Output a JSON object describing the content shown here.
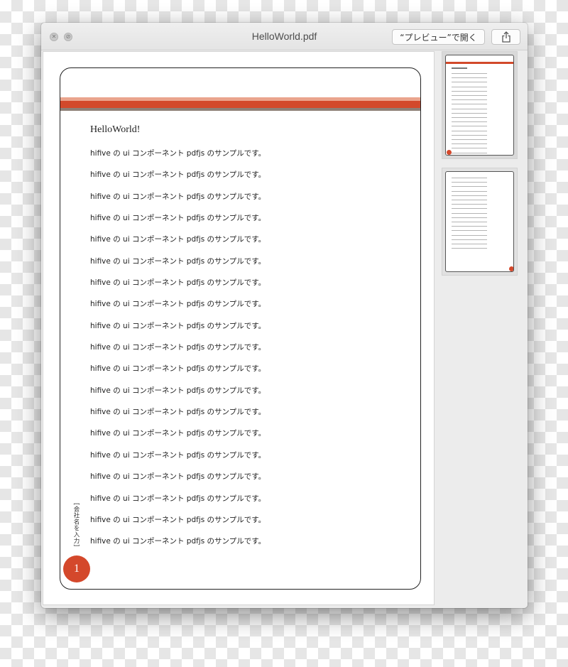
{
  "window": {
    "title": "HelloWorld.pdf",
    "open_button_label": "“プレビュー”で開く",
    "share_icon": "share-icon",
    "close_icon": "close-icon",
    "minimize_icon": "minimize-icon"
  },
  "document": {
    "heading": "HelloWorld!",
    "lines": [
      "hifive の ui コンポーネント pdfjs のサンプルです。",
      "hifive の ui コンポーネント pdfjs のサンプルです。",
      "hifive の ui コンポーネント pdfjs のサンプルです。",
      "hifive の ui コンポーネント pdfjs のサンプルです。",
      "hifive の ui コンポーネント pdfjs のサンプルです。",
      "hifive の ui コンポーネント pdfjs のサンプルです。",
      "hifive の ui コンポーネント pdfjs のサンプルです。",
      "hifive の ui コンポーネント pdfjs のサンプルです。",
      "hifive の ui コンポーネント pdfjs のサンプルです。",
      "hifive の ui コンポーネント pdfjs のサンプルです。",
      "hifive の ui コンポーネント pdfjs のサンプルです。",
      "hifive の ui コンポーネント pdfjs のサンプルです。",
      "hifive の ui コンポーネント pdfjs のサンプルです。",
      "hifive の ui コンポーネント pdfjs のサンプルです。",
      "hifive の ui コンポーネント pdfjs のサンプルです。",
      "hifive の ui コンポーネント pdfjs のサンプルです。",
      "hifive の ui コンポーネント pdfjs のサンプルです。",
      "hifive の ui コンポーネント pdfjs のサンプルです。",
      "hifive の ui コンポーネント pdfjs のサンプルです。"
    ],
    "company_placeholder": "[会社名を入力]",
    "page_number": "1"
  },
  "thumbnails": {
    "count": 2,
    "selected": 1,
    "page1_line_count": 19,
    "page2_line_count": 17
  },
  "colors": {
    "accent": "#d2492b",
    "accent_light": "#eaa48d",
    "band_dark": "#8d7f76",
    "badge": "#d4482b"
  }
}
